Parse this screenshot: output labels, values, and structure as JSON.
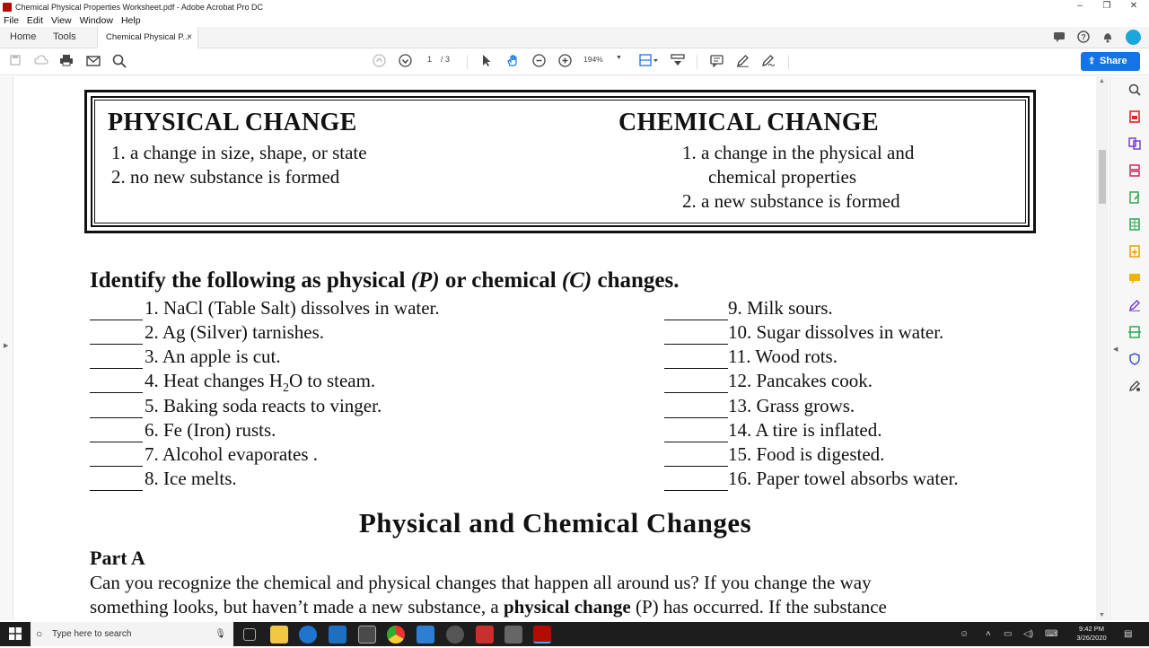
{
  "window": {
    "title": "Chemical Physical Properties Worksheet.pdf - Adobe Acrobat Pro DC",
    "minimize": "–",
    "maximize": "❐",
    "close": "✕"
  },
  "menu": [
    "File",
    "Edit",
    "View",
    "Window",
    "Help"
  ],
  "tabs": {
    "home": "Home",
    "tools": "Tools",
    "document": "Chemical Physical P...",
    "close": "×"
  },
  "toolbar": {
    "page_current": "1",
    "page_total": "/ 3",
    "zoom": "194%",
    "share": "Share"
  },
  "document": {
    "physical_heading": "PHYSICAL CHANGE",
    "physical_items": [
      "1.  a change in size, shape, or state",
      "2.  no new substance is formed"
    ],
    "chemical_heading": "CHEMICAL CHANGE",
    "chemical_items": [
      "1.  a change in the physical and",
      "chemical properties",
      "2.  a new substance is formed"
    ],
    "instruction_a": "Identify the following as physical ",
    "instruction_p": "(P)",
    "instruction_b": " or chemical ",
    "instruction_c": "(C)",
    "instruction_d": " changes.",
    "questions_left": [
      "1.  NaCl (Table Salt) dissolves in water.",
      "2.  Ag (Silver) tarnishes.",
      "3.  An apple is cut.",
      "4.  Heat changes H",
      "5.  Baking soda reacts to vinger.",
      "6.  Fe (Iron) rusts.",
      "7.  Alcohol evaporates  .",
      "8.  Ice melts."
    ],
    "h2o_sub": "2",
    "h2o_rest": "O to steam.",
    "questions_right": [
      "9.  Milk sours.",
      "10.  Sugar dissolves in water.",
      "11.  Wood rots.",
      "12.  Pancakes cook.",
      "13.  Grass grows.",
      "14.  A tire is inflated.",
      "15.  Food is digested.",
      "16.  Paper towel absorbs water."
    ],
    "section_title": "Physical and Chemical Changes",
    "part_a": "Part A",
    "para_line1": "Can you recognize the chemical and physical changes that happen all around us?  If you change the way",
    "para_line2a": "something looks, but haven’t made a new substance, a ",
    "para_line2b": "physical change",
    "para_line2c": " (P) has occurred.  If the substance"
  },
  "taskbar": {
    "search_placeholder": "Type here to search",
    "time": "9:42 PM",
    "date": "3/26/2020"
  }
}
